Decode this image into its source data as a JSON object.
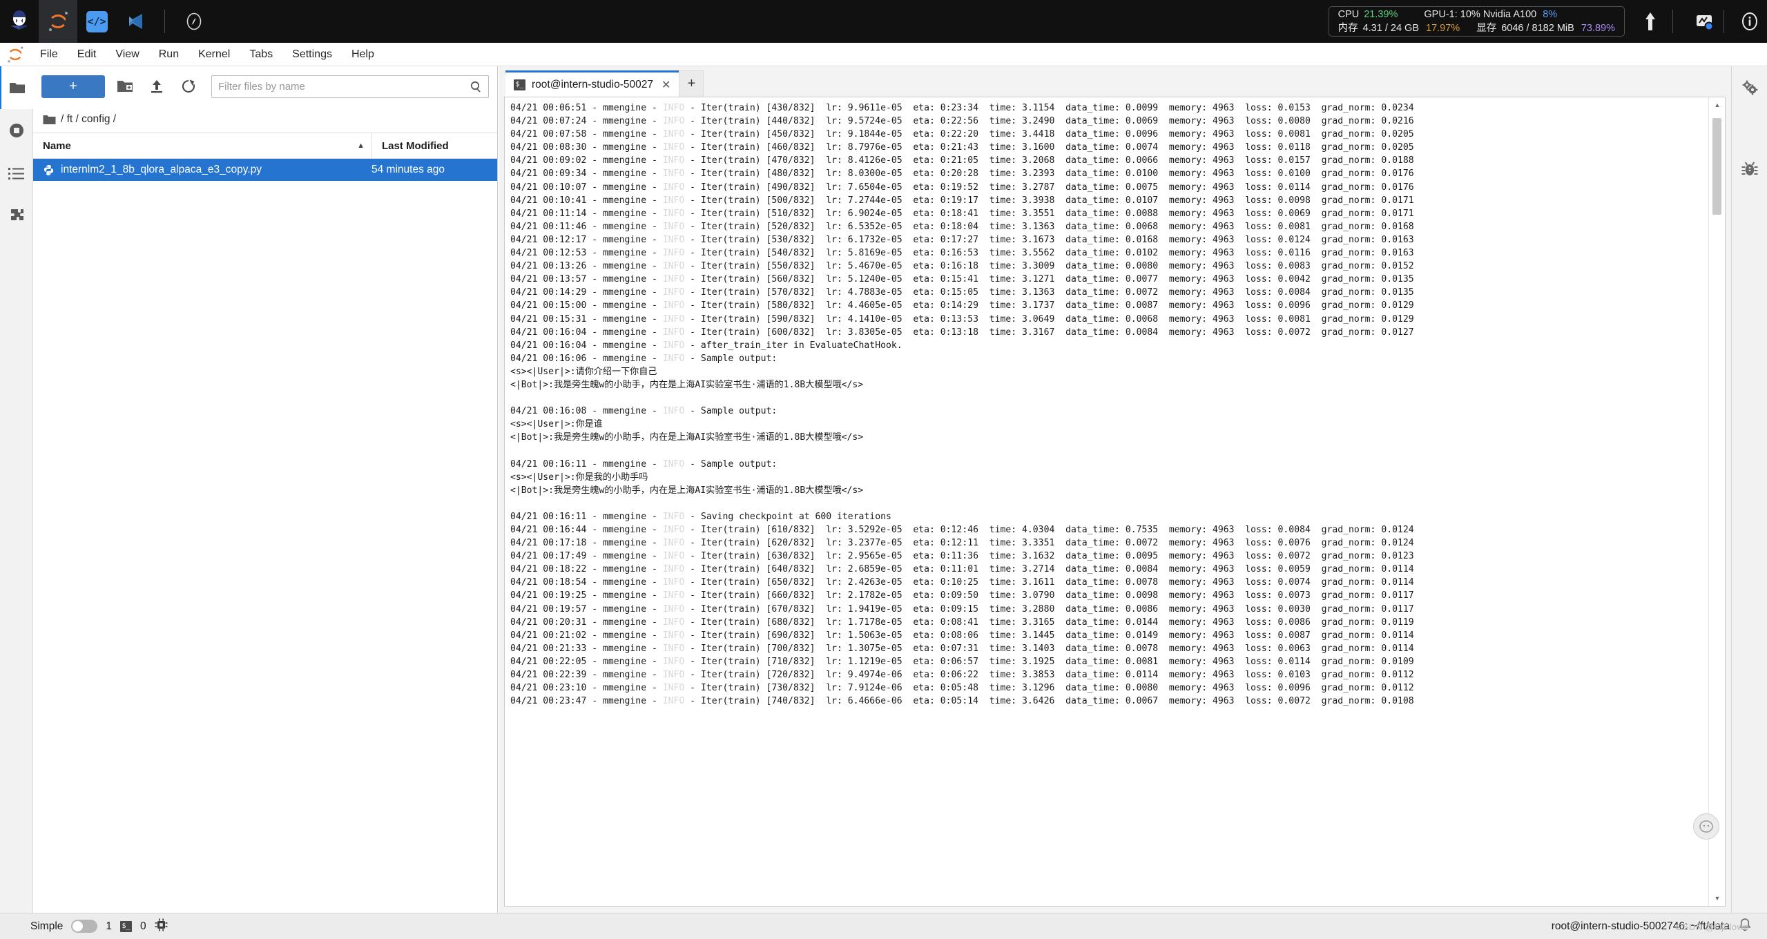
{
  "topbar": {
    "icons": [
      {
        "name": "intern-studio-logo-icon",
        "glyph": "robot"
      },
      {
        "name": "jupyter-logo-icon",
        "glyph": "jupyter"
      },
      {
        "name": "code-server-icon",
        "glyph": "</>"
      },
      {
        "name": "vscode-icon",
        "glyph": "vscode"
      },
      {
        "name": "compass-icon",
        "glyph": "compass"
      }
    ],
    "resources": {
      "cpu_label": "CPU",
      "cpu_value": "21.39%",
      "gpu_label": "GPU-1: 10% Nvidia A100",
      "gpu_value": "8%",
      "mem_label": "内存",
      "mem_value": "4.31 / 24 GB",
      "mem_percent": "17.97%",
      "vram_label": "显存",
      "vram_value": "6046 / 8182 MiB",
      "vram_percent": "73.89%",
      "colors": {
        "cpu": "#5bd078",
        "mem": "#d89b3c",
        "gpu": "#5b9bf0",
        "vram": "#a98bf0"
      }
    },
    "right_buttons": [
      {
        "name": "upload-arrow-icon"
      },
      {
        "name": "monitor-chart-icon"
      },
      {
        "name": "info-icon"
      }
    ]
  },
  "menubar": {
    "items": [
      {
        "label": "File",
        "name": "menu-file"
      },
      {
        "label": "Edit",
        "name": "menu-edit"
      },
      {
        "label": "View",
        "name": "menu-view"
      },
      {
        "label": "Run",
        "name": "menu-run"
      },
      {
        "label": "Kernel",
        "name": "menu-kernel"
      },
      {
        "label": "Tabs",
        "name": "menu-tabs"
      },
      {
        "label": "Settings",
        "name": "menu-settings"
      },
      {
        "label": "Help",
        "name": "menu-help"
      }
    ]
  },
  "left_rail": {
    "items": [
      {
        "name": "sidebar-file-browser-icon",
        "selected": true
      },
      {
        "name": "sidebar-running-kernels-icon",
        "selected": false
      },
      {
        "name": "sidebar-table-of-contents-icon",
        "selected": false
      },
      {
        "name": "sidebar-extensions-icon",
        "selected": false
      }
    ]
  },
  "file_browser": {
    "new_launcher_label": "+",
    "new_folder_label": "new-folder",
    "upload_label": "upload",
    "refresh_label": "refresh",
    "filter": {
      "placeholder": "Filter files by name",
      "value": ""
    },
    "breadcrumb": "/ ft / config /",
    "columns": {
      "name": "Name",
      "last_modified": "Last Modified"
    },
    "sort_indicator": "▲",
    "files": [
      {
        "name": "internlm2_1_8b_qlora_alpaca_e3_copy.py",
        "modified": "54 minutes ago",
        "selected": true,
        "icon": "python-file-icon"
      }
    ]
  },
  "terminal": {
    "tab_title": "root@intern-studio-50027",
    "tab_icon": "terminal-icon",
    "close_label": "✕",
    "new_tab_label": "+",
    "log": "04/21 00:06:51 - mmengine - INFO - Iter(train) [430/832]  lr: 9.9611e-05  eta: 0:23:34  time: 3.1154  data_time: 0.0099  memory: 4963  loss: 0.0153  grad_norm: 0.0234\n04/21 00:07:24 - mmengine - INFO - Iter(train) [440/832]  lr: 9.5724e-05  eta: 0:22:56  time: 3.2490  data_time: 0.0069  memory: 4963  loss: 0.0080  grad_norm: 0.0216\n04/21 00:07:58 - mmengine - INFO - Iter(train) [450/832]  lr: 9.1844e-05  eta: 0:22:20  time: 3.4418  data_time: 0.0096  memory: 4963  loss: 0.0081  grad_norm: 0.0205\n04/21 00:08:30 - mmengine - INFO - Iter(train) [460/832]  lr: 8.7976e-05  eta: 0:21:43  time: 3.1600  data_time: 0.0074  memory: 4963  loss: 0.0118  grad_norm: 0.0205\n04/21 00:09:02 - mmengine - INFO - Iter(train) [470/832]  lr: 8.4126e-05  eta: 0:21:05  time: 3.2068  data_time: 0.0066  memory: 4963  loss: 0.0157  grad_norm: 0.0188\n04/21 00:09:34 - mmengine - INFO - Iter(train) [480/832]  lr: 8.0300e-05  eta: 0:20:28  time: 3.2393  data_time: 0.0100  memory: 4963  loss: 0.0100  grad_norm: 0.0176\n04/21 00:10:07 - mmengine - INFO - Iter(train) [490/832]  lr: 7.6504e-05  eta: 0:19:52  time: 3.2787  data_time: 0.0075  memory: 4963  loss: 0.0114  grad_norm: 0.0176\n04/21 00:10:41 - mmengine - INFO - Iter(train) [500/832]  lr: 7.2744e-05  eta: 0:19:17  time: 3.3938  data_time: 0.0107  memory: 4963  loss: 0.0098  grad_norm: 0.0171\n04/21 00:11:14 - mmengine - INFO - Iter(train) [510/832]  lr: 6.9024e-05  eta: 0:18:41  time: 3.3551  data_time: 0.0088  memory: 4963  loss: 0.0069  grad_norm: 0.0171\n04/21 00:11:46 - mmengine - INFO - Iter(train) [520/832]  lr: 6.5352e-05  eta: 0:18:04  time: 3.1363  data_time: 0.0068  memory: 4963  loss: 0.0081  grad_norm: 0.0168\n04/21 00:12:17 - mmengine - INFO - Iter(train) [530/832]  lr: 6.1732e-05  eta: 0:17:27  time: 3.1673  data_time: 0.0168  memory: 4963  loss: 0.0124  grad_norm: 0.0163\n04/21 00:12:53 - mmengine - INFO - Iter(train) [540/832]  lr: 5.8169e-05  eta: 0:16:53  time: 3.5562  data_time: 0.0102  memory: 4963  loss: 0.0116  grad_norm: 0.0163\n04/21 00:13:26 - mmengine - INFO - Iter(train) [550/832]  lr: 5.4670e-05  eta: 0:16:18  time: 3.3009  data_time: 0.0080  memory: 4963  loss: 0.0083  grad_norm: 0.0152\n04/21 00:13:57 - mmengine - INFO - Iter(train) [560/832]  lr: 5.1240e-05  eta: 0:15:41  time: 3.1271  data_time: 0.0077  memory: 4963  loss: 0.0042  grad_norm: 0.0135\n04/21 00:14:29 - mmengine - INFO - Iter(train) [570/832]  lr: 4.7883e-05  eta: 0:15:05  time: 3.1363  data_time: 0.0072  memory: 4963  loss: 0.0084  grad_norm: 0.0135\n04/21 00:15:00 - mmengine - INFO - Iter(train) [580/832]  lr: 4.4605e-05  eta: 0:14:29  time: 3.1737  data_time: 0.0087  memory: 4963  loss: 0.0096  grad_norm: 0.0129\n04/21 00:15:31 - mmengine - INFO - Iter(train) [590/832]  lr: 4.1410e-05  eta: 0:13:53  time: 3.0649  data_time: 0.0068  memory: 4963  loss: 0.0081  grad_norm: 0.0129\n04/21 00:16:04 - mmengine - INFO - Iter(train) [600/832]  lr: 3.8305e-05  eta: 0:13:18  time: 3.3167  data_time: 0.0084  memory: 4963  loss: 0.0072  grad_norm: 0.0127\n04/21 00:16:04 - mmengine - INFO - after_train_iter in EvaluateChatHook.\n04/21 00:16:06 - mmengine - INFO - Sample output:\n<s><|User|>:请你介绍一下你自己\n<|Bot|>:我是旁生魄w的小助手，内在是上海AI实验室书生·浦语的1.8B大模型哦</s>\n\n04/21 00:16:08 - mmengine - INFO - Sample output:\n<s><|User|>:你是谁\n<|Bot|>:我是旁生魄w的小助手，内在是上海AI实验室书生·浦语的1.8B大模型哦</s>\n\n04/21 00:16:11 - mmengine - INFO - Sample output:\n<s><|User|>:你是我的小助手吗\n<|Bot|>:我是旁生魄w的小助手，内在是上海AI实验室书生·浦语的1.8B大模型哦</s>\n\n04/21 00:16:11 - mmengine - INFO - Saving checkpoint at 600 iterations\n04/21 00:16:44 - mmengine - INFO - Iter(train) [610/832]  lr: 3.5292e-05  eta: 0:12:46  time: 4.0304  data_time: 0.7535  memory: 4963  loss: 0.0084  grad_norm: 0.0124\n04/21 00:17:18 - mmengine - INFO - Iter(train) [620/832]  lr: 3.2377e-05  eta: 0:12:11  time: 3.3351  data_time: 0.0072  memory: 4963  loss: 0.0076  grad_norm: 0.0124\n04/21 00:17:49 - mmengine - INFO - Iter(train) [630/832]  lr: 2.9565e-05  eta: 0:11:36  time: 3.1632  data_time: 0.0095  memory: 4963  loss: 0.0072  grad_norm: 0.0123\n04/21 00:18:22 - mmengine - INFO - Iter(train) [640/832]  lr: 2.6859e-05  eta: 0:11:01  time: 3.2714  data_time: 0.0084  memory: 4963  loss: 0.0059  grad_norm: 0.0114\n04/21 00:18:54 - mmengine - INFO - Iter(train) [650/832]  lr: 2.4263e-05  eta: 0:10:25  time: 3.1611  data_time: 0.0078  memory: 4963  loss: 0.0074  grad_norm: 0.0114\n04/21 00:19:25 - mmengine - INFO - Iter(train) [660/832]  lr: 2.1782e-05  eta: 0:09:50  time: 3.0790  data_time: 0.0098  memory: 4963  loss: 0.0073  grad_norm: 0.0117\n04/21 00:19:57 - mmengine - INFO - Iter(train) [670/832]  lr: 1.9419e-05  eta: 0:09:15  time: 3.2880  data_time: 0.0086  memory: 4963  loss: 0.0030  grad_norm: 0.0117\n04/21 00:20:31 - mmengine - INFO - Iter(train) [680/832]  lr: 1.7178e-05  eta: 0:08:41  time: 3.3165  data_time: 0.0144  memory: 4963  loss: 0.0086  grad_norm: 0.0119\n04/21 00:21:02 - mmengine - INFO - Iter(train) [690/832]  lr: 1.5063e-05  eta: 0:08:06  time: 3.1445  data_time: 0.0149  memory: 4963  loss: 0.0087  grad_norm: 0.0114\n04/21 00:21:33 - mmengine - INFO - Iter(train) [700/832]  lr: 1.3075e-05  eta: 0:07:31  time: 3.1403  data_time: 0.0078  memory: 4963  loss: 0.0063  grad_norm: 0.0114\n04/21 00:22:05 - mmengine - INFO - Iter(train) [710/832]  lr: 1.1219e-05  eta: 0:06:57  time: 3.1925  data_time: 0.0081  memory: 4963  loss: 0.0114  grad_norm: 0.0109\n04/21 00:22:39 - mmengine - INFO - Iter(train) [720/832]  lr: 9.4974e-06  eta: 0:06:22  time: 3.3853  data_time: 0.0114  memory: 4963  loss: 0.0103  grad_norm: 0.0112\n04/21 00:23:10 - mmengine - INFO - Iter(train) [730/832]  lr: 7.9124e-06  eta: 0:05:48  time: 3.1296  data_time: 0.0080  memory: 4963  loss: 0.0096  grad_norm: 0.0112\n04/21 00:23:47 - mmengine - INFO - Iter(train) [740/832]  lr: 6.4666e-06  eta: 0:05:14  time: 3.6426  data_time: 0.0067  memory: 4963  loss: 0.0072  grad_norm: 0.0108"
  },
  "right_rail": {
    "items": [
      {
        "name": "property-inspector-gear-icon"
      },
      {
        "name": "debugger-bug-icon"
      }
    ]
  },
  "statusbar": {
    "simple_label": "Simple",
    "toggle_on": false,
    "kernel_count": "1",
    "terminal_count": "0",
    "terminal_icon": "terminal-icon",
    "cpu_icon": "cpu-chip-icon",
    "session_path": "root@intern-studio-5002746: ~/ft/data",
    "watermark": "CSDN @DjFlown",
    "notification_icon": "bell-icon"
  }
}
